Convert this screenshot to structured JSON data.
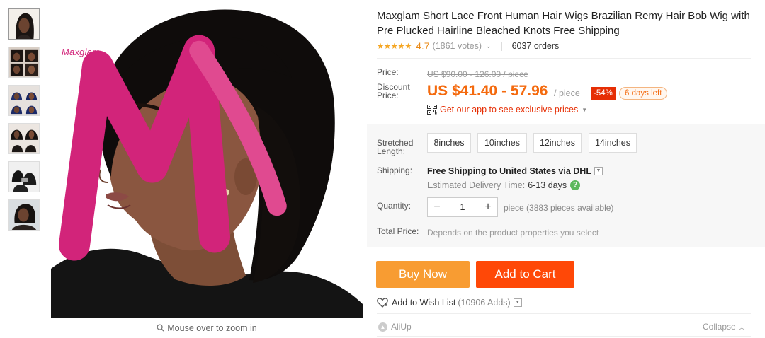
{
  "logo": {
    "text": "Maxglam"
  },
  "gallery": {
    "thumbnails": [
      "thumbnail-1",
      "thumbnail-2",
      "thumbnail-3",
      "thumbnail-4",
      "thumbnail-5",
      "thumbnail-6"
    ],
    "zoom_hint": "Mouse over to zoom in"
  },
  "product": {
    "title": "Maxglam Short Lace Front Human Hair Wigs Brazilian Remy Hair Bob Wig with Pre Plucked Hairline Bleached Knots Free Shipping",
    "rating": {
      "stars": "★★★★★",
      "value": "4.7",
      "votes": "(1861 votes)",
      "orders": "6037 orders"
    },
    "price": {
      "label": "Price:",
      "original": "US $90.00 - 126.00 / piece",
      "discount_label_1": "Discount",
      "discount_label_2": "Price:",
      "discount": "US $41.40 - 57.96",
      "unit": "/ piece",
      "percent_off": "-54%",
      "time_left": "6 days left",
      "app_promo": "Get our app to see exclusive prices"
    },
    "options": {
      "length_label_1": "Stretched",
      "length_label_2": "Length:",
      "lengths": [
        "8inches",
        "10inches",
        "12inches",
        "14inches"
      ],
      "shipping_label": "Shipping:",
      "shipping": "Free Shipping to United States via DHL",
      "eta_label": "Estimated Delivery Time:",
      "eta_value": "6-13 days",
      "quantity_label": "Quantity:",
      "quantity": "1",
      "available": "piece (3883 pieces available)",
      "total_label": "Total Price:",
      "total_value": "Depends on the product properties you select"
    },
    "actions": {
      "buy_now": "Buy Now",
      "add_to_cart": "Add to Cart",
      "wishlist": "Add to Wish List",
      "wishlist_count": "(10906 Adds)"
    },
    "footer": {
      "aliup": "AliUp",
      "collapse": "Collapse"
    }
  },
  "colors": {
    "price_orange": "#f46a0e",
    "badge_red": "#e62e04",
    "buy_now_bg": "#f89c32",
    "add_to_cart_bg": "#ff4807",
    "star": "#f5a623",
    "logo_pink": "#d2247a"
  }
}
